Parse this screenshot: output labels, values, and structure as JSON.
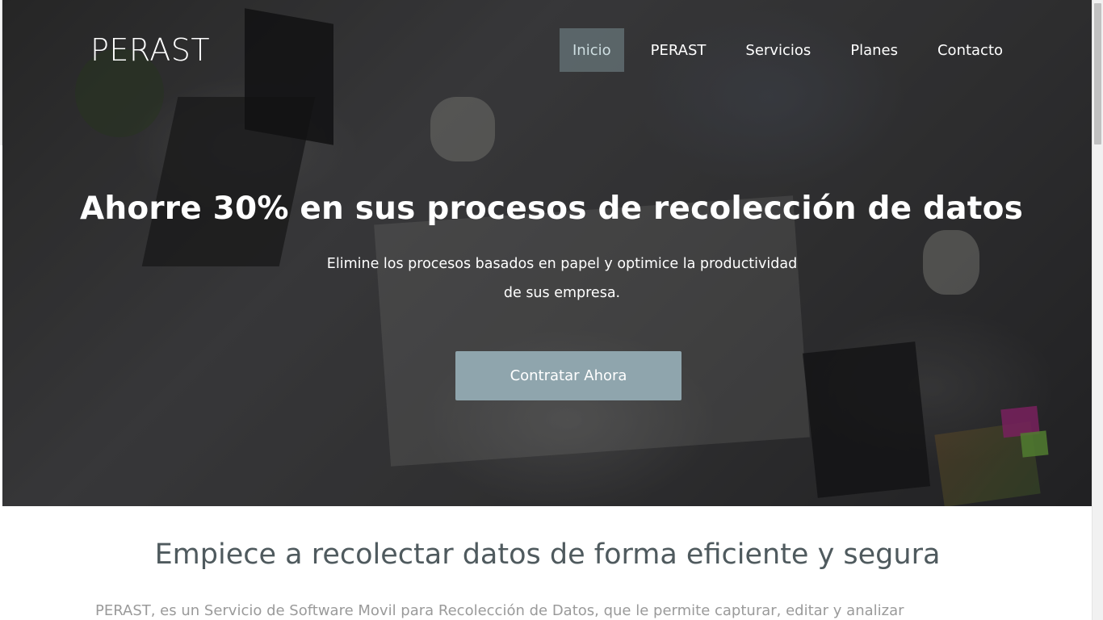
{
  "brand": "PERAST",
  "nav": {
    "items": [
      {
        "label": "Inicio",
        "active": true
      },
      {
        "label": "PERAST",
        "active": false
      },
      {
        "label": "Servicios",
        "active": false
      },
      {
        "label": "Planes",
        "active": false
      },
      {
        "label": "Contacto",
        "active": false
      }
    ]
  },
  "hero": {
    "headline": "Ahorre 30% en sus procesos de recolección de datos",
    "subline_1": "Elimine los procesos basados en papel y optimice la productividad",
    "subline_2": "de sus empresa.",
    "cta_label": "Contratar Ahora"
  },
  "section": {
    "title": "Empiece a recolectar datos de forma eficiente y segura",
    "text": "PERAST, es un Servicio de Software Movil para Recolección de Datos, que le permite capturar, editar y analizar"
  },
  "colors": {
    "cta_bg": "#8fa5ad",
    "nav_active_bg": "#6f878c",
    "title_text": "#4f5a5e",
    "body_text": "#9a9a9a"
  }
}
